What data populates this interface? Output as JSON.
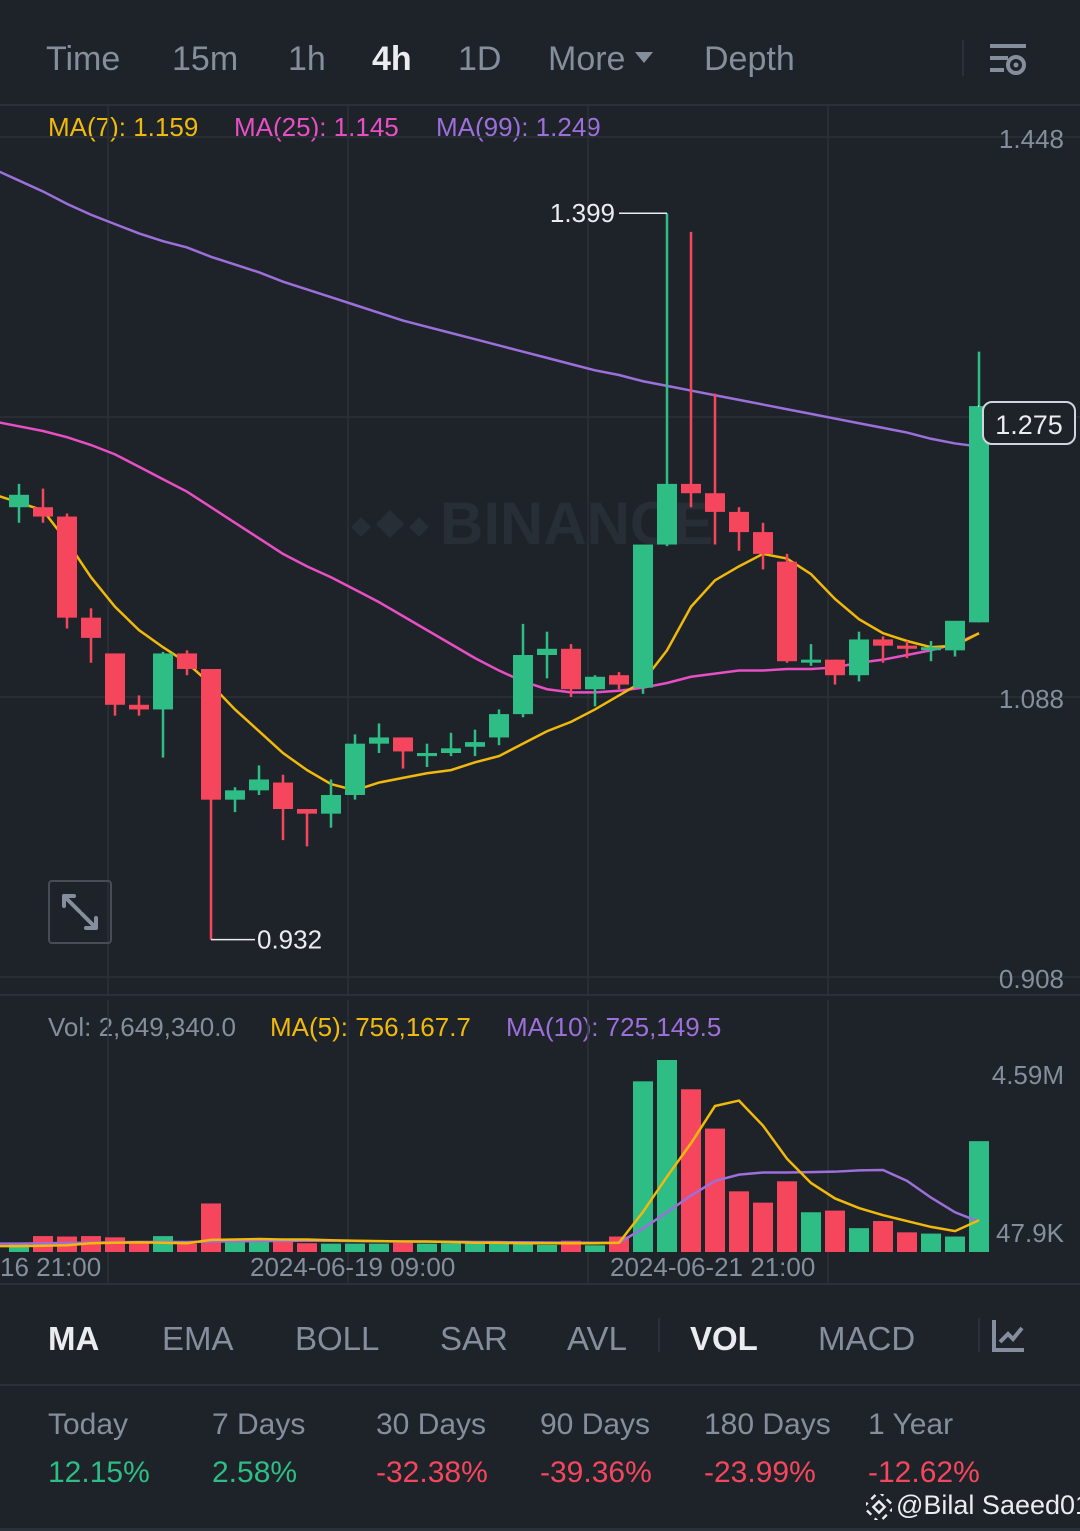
{
  "toolbar": {
    "timeframes": [
      "Time",
      "15m",
      "1h",
      "4h",
      "1D"
    ],
    "more_label": "More",
    "depth_label": "Depth",
    "active": "4h"
  },
  "ma_legend": {
    "ma7": "MA(7): 1.159",
    "ma25": "MA(25): 1.145",
    "ma99": "MA(99): 1.249"
  },
  "price_axis": {
    "top": "1.448",
    "mid": "1.088",
    "bottom": "0.908"
  },
  "annotations": {
    "high": "1.399",
    "low": "0.932",
    "last_price": "1.275"
  },
  "watermark_brand": "BINANCE",
  "vol_legend": {
    "vol": "Vol: 2,649,340.0",
    "ma5": "MA(5): 756,167.7",
    "ma10": "MA(10): 725,149.5"
  },
  "vol_axis": {
    "top": "4.59M",
    "bottom": "47.9K"
  },
  "time_axis": [
    "16 21:00",
    "2024-06-19 09:00",
    "2024-06-21 21:00"
  ],
  "indicators": [
    "MA",
    "EMA",
    "BOLL",
    "SAR",
    "AVL",
    "VOL",
    "MACD"
  ],
  "active_indicators": [
    "MA",
    "VOL"
  ],
  "performance": [
    {
      "label": "Today",
      "value": "12.15%",
      "positive": true
    },
    {
      "label": "7 Days",
      "value": "2.58%",
      "positive": true
    },
    {
      "label": "30 Days",
      "value": "-32.38%",
      "positive": false
    },
    {
      "label": "90 Days",
      "value": "-39.36%",
      "positive": false
    },
    {
      "label": "180 Days",
      "value": "-23.99%",
      "positive": false
    },
    {
      "label": "1 Year",
      "value": "-12.62%",
      "positive": false
    }
  ],
  "credit": "@Bilal Saeed01",
  "colors": {
    "bg": "#1e2329",
    "up": "#2ebd85",
    "down": "#f6465d",
    "ma7": "#f0b90b",
    "ma25": "#e84fc5",
    "ma99": "#9c6fdb",
    "text": "#848e9c"
  },
  "chart_data": {
    "type": "candlestick",
    "interval": "4h",
    "y_axis": {
      "min": 0.908,
      "max": 1.448,
      "ticks": [
        0.908,
        1.088,
        1.448
      ]
    },
    "candles": [
      {
        "o": 1.21,
        "h": 1.225,
        "l": 1.2,
        "c": 1.218
      },
      {
        "o": 1.21,
        "h": 1.222,
        "l": 1.2,
        "c": 1.204
      },
      {
        "o": 1.204,
        "h": 1.206,
        "l": 1.132,
        "c": 1.139
      },
      {
        "o": 1.139,
        "h": 1.145,
        "l": 1.11,
        "c": 1.126
      },
      {
        "o": 1.116,
        "h": 1.116,
        "l": 1.076,
        "c": 1.083
      },
      {
        "o": 1.083,
        "h": 1.089,
        "l": 1.076,
        "c": 1.08
      },
      {
        "o": 1.08,
        "h": 1.117,
        "l": 1.049,
        "c": 1.116
      },
      {
        "o": 1.116,
        "h": 1.118,
        "l": 1.102,
        "c": 1.106
      },
      {
        "o": 1.106,
        "h": 1.106,
        "l": 0.932,
        "c": 1.022
      },
      {
        "o": 1.022,
        "h": 1.03,
        "l": 1.014,
        "c": 1.028
      },
      {
        "o": 1.028,
        "h": 1.044,
        "l": 1.025,
        "c": 1.035
      },
      {
        "o": 1.033,
        "h": 1.038,
        "l": 0.996,
        "c": 1.016
      },
      {
        "o": 1.016,
        "h": 1.016,
        "l": 0.992,
        "c": 1.013
      },
      {
        "o": 1.013,
        "h": 1.035,
        "l": 1.004,
        "c": 1.025
      },
      {
        "o": 1.025,
        "h": 1.064,
        "l": 1.022,
        "c": 1.058
      },
      {
        "o": 1.058,
        "h": 1.071,
        "l": 1.052,
        "c": 1.062
      },
      {
        "o": 1.062,
        "h": 1.062,
        "l": 1.042,
        "c": 1.053
      },
      {
        "o": 1.05,
        "h": 1.058,
        "l": 1.043,
        "c": 1.052
      },
      {
        "o": 1.052,
        "h": 1.065,
        "l": 1.05,
        "c": 1.055
      },
      {
        "o": 1.056,
        "h": 1.067,
        "l": 1.05,
        "c": 1.059
      },
      {
        "o": 1.062,
        "h": 1.08,
        "l": 1.057,
        "c": 1.077
      },
      {
        "o": 1.077,
        "h": 1.135,
        "l": 1.075,
        "c": 1.115
      },
      {
        "o": 1.115,
        "h": 1.13,
        "l": 1.1,
        "c": 1.119
      },
      {
        "o": 1.119,
        "h": 1.122,
        "l": 1.088,
        "c": 1.093
      },
      {
        "o": 1.093,
        "h": 1.102,
        "l": 1.082,
        "c": 1.101
      },
      {
        "o": 1.102,
        "h": 1.104,
        "l": 1.093,
        "c": 1.096
      },
      {
        "o": 1.094,
        "h": 1.185,
        "l": 1.09,
        "c": 1.186
      },
      {
        "o": 1.186,
        "h": 1.399,
        "l": 1.185,
        "c": 1.225
      },
      {
        "o": 1.225,
        "h": 1.387,
        "l": 1.21,
        "c": 1.219
      },
      {
        "o": 1.219,
        "h": 1.283,
        "l": 1.186,
        "c": 1.207
      },
      {
        "o": 1.207,
        "h": 1.21,
        "l": 1.182,
        "c": 1.194
      },
      {
        "o": 1.194,
        "h": 1.2,
        "l": 1.17,
        "c": 1.18
      },
      {
        "o": 1.175,
        "h": 1.18,
        "l": 1.11,
        "c": 1.111
      },
      {
        "o": 1.111,
        "h": 1.122,
        "l": 1.108,
        "c": 1.112
      },
      {
        "o": 1.112,
        "h": 1.112,
        "l": 1.096,
        "c": 1.102
      },
      {
        "o": 1.102,
        "h": 1.13,
        "l": 1.098,
        "c": 1.125
      },
      {
        "o": 1.125,
        "h": 1.127,
        "l": 1.11,
        "c": 1.121
      },
      {
        "o": 1.121,
        "h": 1.124,
        "l": 1.113,
        "c": 1.119
      },
      {
        "o": 1.119,
        "h": 1.124,
        "l": 1.111,
        "c": 1.12
      },
      {
        "o": 1.118,
        "h": 1.136,
        "l": 1.114,
        "c": 1.137
      },
      {
        "o": 1.136,
        "h": 1.31,
        "l": 1.136,
        "c": 1.275
      }
    ],
    "ma7": [
      1.213,
      1.208,
      1.188,
      1.165,
      1.146,
      1.131,
      1.12,
      1.11,
      1.096,
      1.08,
      1.066,
      1.052,
      1.041,
      1.032,
      1.028,
      1.033,
      1.036,
      1.039,
      1.041,
      1.046,
      1.05,
      1.058,
      1.066,
      1.072,
      1.08,
      1.089,
      1.098,
      1.118,
      1.146,
      1.163,
      1.172,
      1.18,
      1.177,
      1.167,
      1.151,
      1.138,
      1.129,
      1.124,
      1.12,
      1.121,
      1.129
    ],
    "ma25": [
      1.262,
      1.259,
      1.255,
      1.25,
      1.244,
      1.236,
      1.228,
      1.22,
      1.21,
      1.2,
      1.19,
      1.18,
      1.172,
      1.165,
      1.157,
      1.149,
      1.14,
      1.131,
      1.122,
      1.113,
      1.105,
      1.098,
      1.093,
      1.091,
      1.091,
      1.092,
      1.094,
      1.097,
      1.101,
      1.103,
      1.105,
      1.105,
      1.106,
      1.106,
      1.107,
      1.11,
      1.112,
      1.115,
      1.118,
      1.122,
      1.129
    ],
    "ma99": [
      1.42,
      1.413,
      1.405,
      1.398,
      1.392,
      1.386,
      1.381,
      1.377,
      1.371,
      1.366,
      1.361,
      1.355,
      1.35,
      1.345,
      1.34,
      1.335,
      1.33,
      1.326,
      1.322,
      1.318,
      1.314,
      1.31,
      1.306,
      1.302,
      1.298,
      1.295,
      1.291,
      1.288,
      1.285,
      1.282,
      1.279,
      1.276,
      1.273,
      1.27,
      1.267,
      1.264,
      1.261,
      1.258,
      1.254,
      1.251,
      1.249
    ],
    "volume": {
      "max_value": 4590000,
      "values": [
        210000,
        380000,
        370000,
        380000,
        350000,
        220000,
        380000,
        200000,
        1160000,
        260000,
        250000,
        290000,
        210000,
        200000,
        200000,
        200000,
        220000,
        200000,
        210000,
        250000,
        210000,
        190000,
        170000,
        270000,
        160000,
        370000,
        4080000,
        4590000,
        3890000,
        2950000,
        1450000,
        1180000,
        1690000,
        950000,
        990000,
        570000,
        740000,
        470000,
        440000,
        370000,
        2650000
      ],
      "ma5": [
        140000,
        150000,
        160000,
        210000,
        220000,
        230000,
        220000,
        210000,
        290000,
        300000,
        310000,
        300000,
        300000,
        280000,
        270000,
        260000,
        250000,
        250000,
        240000,
        220000,
        220000,
        210000,
        210000,
        210000,
        210000,
        220000,
        960000,
        1800000,
        2600000,
        3490000,
        3620000,
        3020000,
        2230000,
        1650000,
        1280000,
        1050000,
        880000,
        740000,
        600000,
        500000,
        760000
      ],
      "ma10": [
        200000,
        210000,
        215000,
        225000,
        230000,
        240000,
        240000,
        240000,
        250000,
        255000,
        260000,
        265000,
        270000,
        268000,
        262000,
        258000,
        252000,
        248000,
        244000,
        240000,
        236000,
        232000,
        228000,
        224000,
        220000,
        222000,
        560000,
        950000,
        1350000,
        1700000,
        1850000,
        1900000,
        1900000,
        1910000,
        1920000,
        1950000,
        1960000,
        1700000,
        1300000,
        950000,
        725149
      ]
    }
  }
}
